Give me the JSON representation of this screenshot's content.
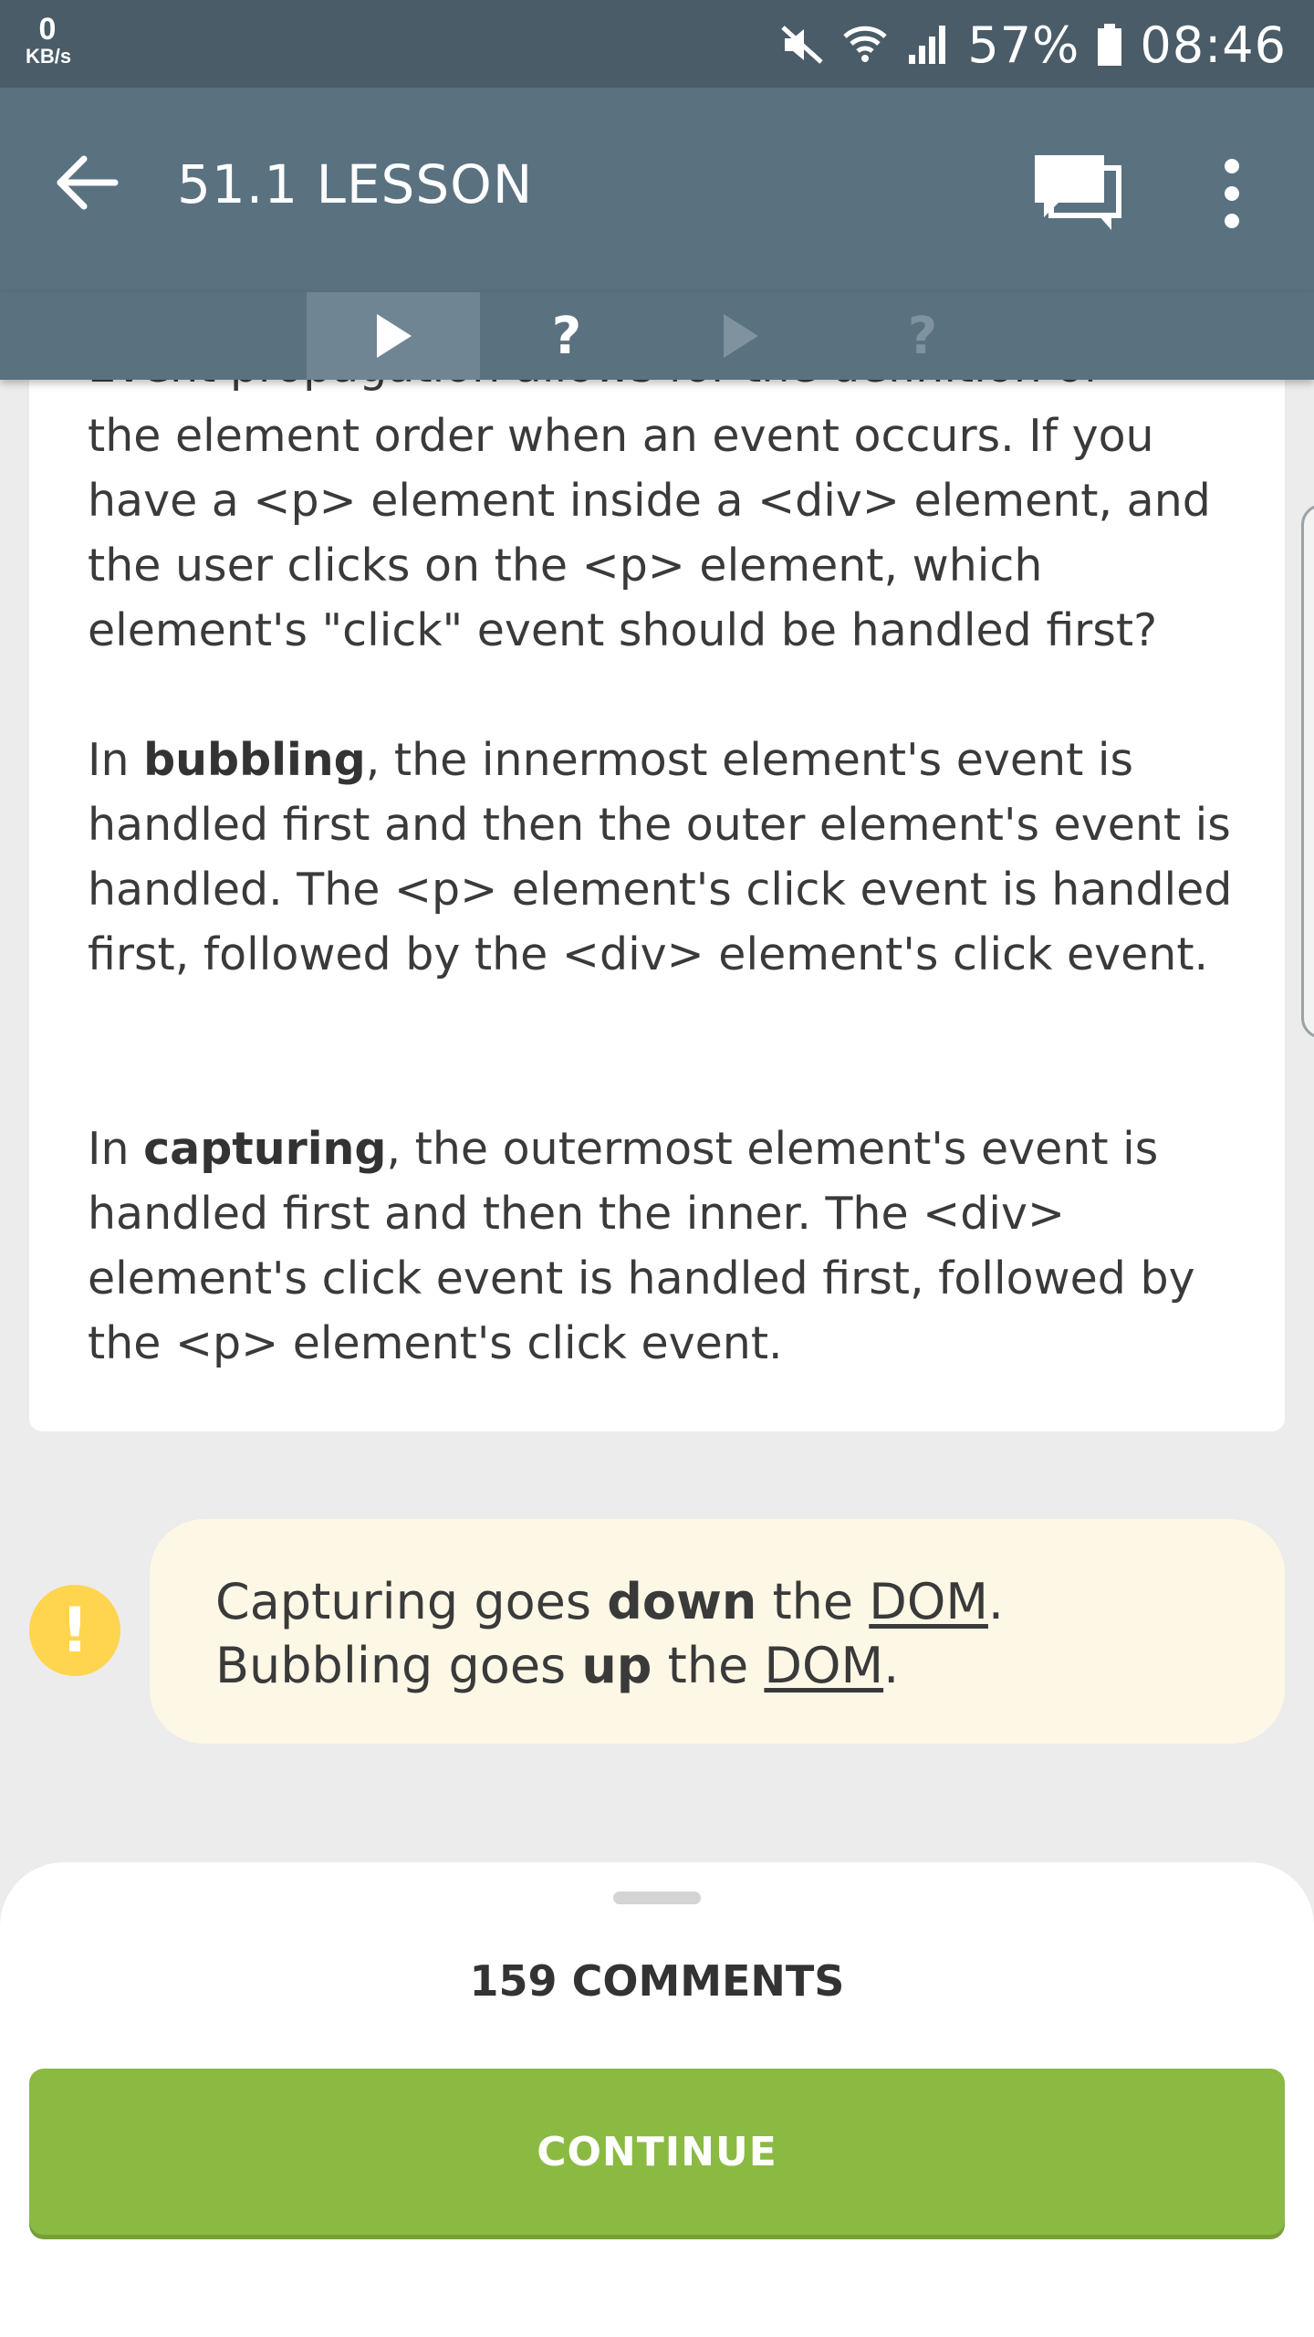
{
  "status_bar": {
    "net_speed_value": "0",
    "net_speed_unit": "KB/s",
    "battery": "57%",
    "time": "08:46",
    "icons": [
      "mute-icon",
      "wifi-icon",
      "signal-icon",
      "battery-icon"
    ]
  },
  "app_bar": {
    "title": "51.1 LESSON",
    "icons": [
      "back-arrow-icon",
      "comments-icon",
      "more-vert-icon"
    ]
  },
  "tabs": [
    {
      "type": "lesson",
      "icon": "play-icon",
      "active": true
    },
    {
      "type": "quiz",
      "label": "?",
      "active": false
    },
    {
      "type": "lesson",
      "icon": "play-icon",
      "active": false
    },
    {
      "type": "quiz",
      "label": "?",
      "active": false
    }
  ],
  "lesson": {
    "cutoff_line": "Event propagation allows for the definition of",
    "p1": "the element order when an event occurs. If you have a <p> element inside a <div> element, and the user clicks on the <p> element, which element's \"click\" event should be handled first?",
    "p2_prefix": "In ",
    "p2_bold": "bubbling",
    "p2_rest": ", the innermost element's event is handled first and then the outer element's event is handled. The <p> element's click event is handled first, followed by the <div> element's click event.",
    "p3_prefix": "In ",
    "p3_bold": "capturing",
    "p3_rest": ", the outermost element's event is handled first and then the inner. The <div> element's click event is handled first, followed by the <p> element's click event."
  },
  "hint": {
    "icon_label": "!",
    "line1": {
      "a": "Capturing goes ",
      "bold": "down",
      "b": " the ",
      "link": "DOM",
      "end": "."
    },
    "line2": {
      "a": "Bubbling goes ",
      "bold": "up",
      "b": " the ",
      "link": "DOM",
      "end": "."
    }
  },
  "sheet": {
    "comments_label": "159 COMMENTS",
    "continue_label": "CONTINUE"
  },
  "colors": {
    "status_bar": "#495c68",
    "app_bar": "#5a7180",
    "active_tab": "#6f8593",
    "continue": "#8aba42",
    "hint_bg": "#fdf8e6",
    "warning": "#ffd54f"
  }
}
